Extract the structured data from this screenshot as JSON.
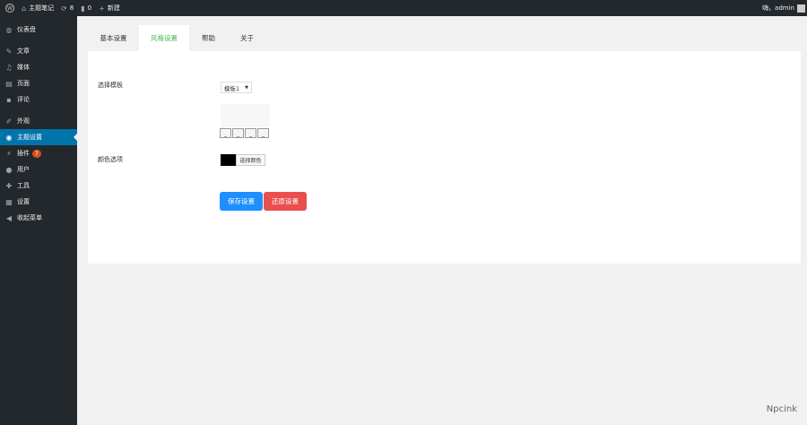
{
  "admin_bar": {
    "site_name": "主题笔记",
    "updates_count": "8",
    "comments_count": "0",
    "new_label": "新建",
    "greeting": "嗨，admin"
  },
  "sidebar": {
    "items": [
      {
        "label": "仪表盘",
        "icon": "dashboard-icon"
      },
      {
        "label": "文章",
        "icon": "pin-icon"
      },
      {
        "label": "媒体",
        "icon": "media-icon"
      },
      {
        "label": "页面",
        "icon": "page-icon"
      },
      {
        "label": "评论",
        "icon": "comment-icon"
      },
      {
        "label": "外观",
        "icon": "brush-icon"
      },
      {
        "label": "主题设置",
        "icon": "globe-icon"
      },
      {
        "label": "插件",
        "icon": "plugin-icon",
        "badge": "7"
      },
      {
        "label": "用户",
        "icon": "user-icon"
      },
      {
        "label": "工具",
        "icon": "wrench-icon"
      },
      {
        "label": "设置",
        "icon": "settings-icon"
      },
      {
        "label": "收起菜单",
        "icon": "collapse-icon"
      }
    ]
  },
  "tabs": [
    {
      "label": "基本设置"
    },
    {
      "label": "风格设置"
    },
    {
      "label": "帮助"
    },
    {
      "label": "关于"
    }
  ],
  "form": {
    "template_label": "选择模板",
    "template_value": "模板1",
    "small_buttons": [
      "_",
      "_",
      "_",
      "_"
    ],
    "color_label": "颜色选项",
    "color_value": "#000000",
    "color_button": "选择颜色",
    "save_button": "保存设置",
    "reset_button": "还原设置"
  },
  "watermark": "Npcink",
  "colors": {
    "adminbar": "#23282d",
    "active_menu": "#0073aa",
    "active_tab_text": "#46b450",
    "save": "#1e8fff",
    "reset": "#ea4f4f"
  }
}
